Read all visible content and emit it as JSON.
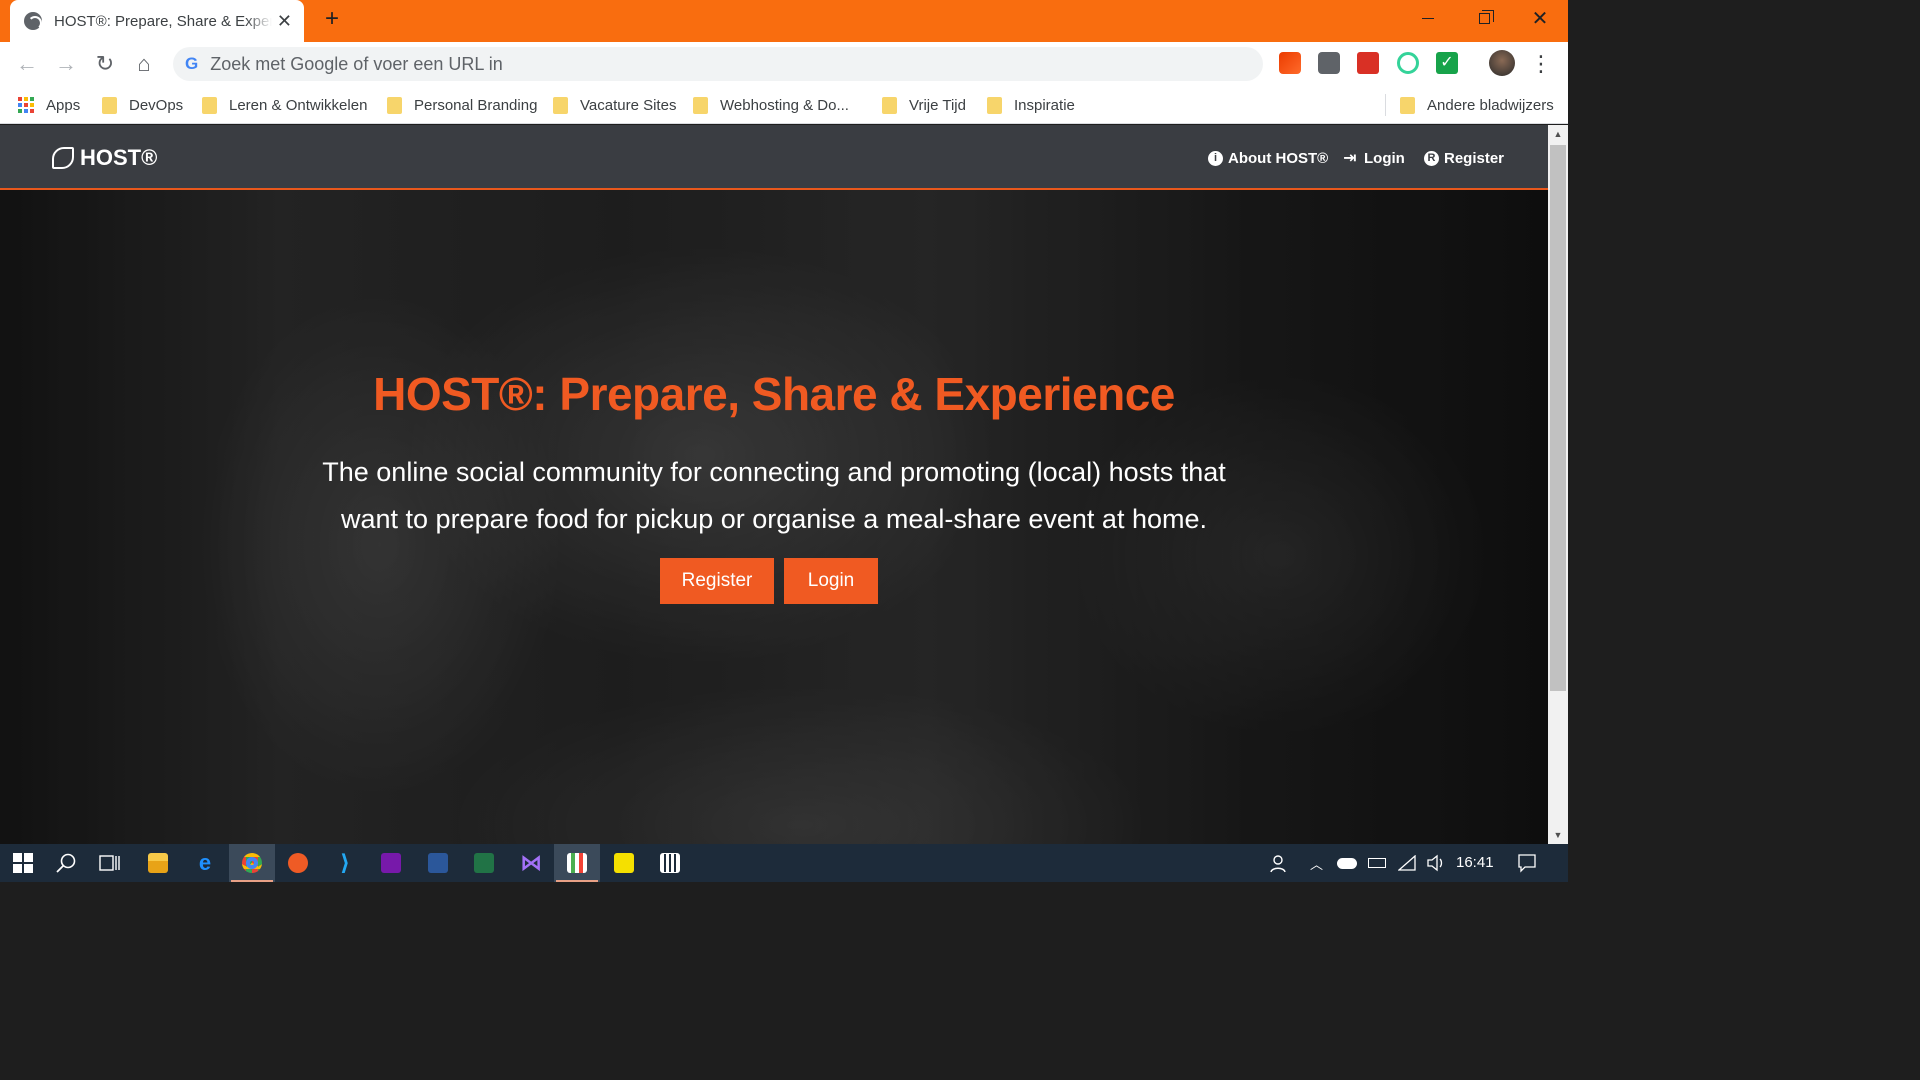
{
  "browser": {
    "tab_title": "HOST®: Prepare, Share & Experience",
    "tab_close": "✕",
    "new_tab": "+",
    "window_close": "✕",
    "omnibox_placeholder": "Zoek met Google of voer een URL in",
    "google_letter": "G",
    "nav_back": "←",
    "nav_forward": "→",
    "nav_reload": "↻",
    "nav_home": "⌂",
    "menu": "⋮",
    "extension_icons": [
      "office-icon",
      "c-extension-icon",
      "puzzle-extension-icon",
      "recorder-extension-icon",
      "checkmark-extension-icon",
      "profile-avatar"
    ],
    "colors": {
      "titlebar": "#f96d0f",
      "omnibox": "#f1f3f4"
    }
  },
  "bookmarks": {
    "apps_label": "Apps",
    "items": [
      "DevOps",
      "Leren & Ontwikkelen",
      "Personal Branding",
      "Vacature Sites",
      "Webhosting & Do...",
      "Vrije Tijd",
      "Inspiratie"
    ],
    "other": "Andere bladwijzers"
  },
  "site": {
    "brand": "HOST®",
    "nav": {
      "about": "About HOST®",
      "login": "Login",
      "register": "Register"
    },
    "hero": {
      "title": "HOST®: Prepare, Share & Experience",
      "subtitle_line1": "The online social community for connecting and promoting (local) hosts that",
      "subtitle_line2": "want to prepare food for pickup or organise a meal-share event at home.",
      "register_button": "Register",
      "login_button": "Login"
    },
    "colors": {
      "accent": "#f05a22",
      "navbar": "#3a3d42"
    }
  },
  "taskbar": {
    "apps": [
      "start-icon",
      "search-icon",
      "task-view-icon",
      "file-explorer-icon",
      "edge-icon",
      "chrome-icon",
      "postman-icon",
      "vscode-icon",
      "onenote-icon",
      "word-icon",
      "excel-icon",
      "visual-studio-icon",
      "charts-app-icon",
      "sticky-notes-icon",
      "calculator-icon"
    ],
    "clock": "16:41"
  }
}
